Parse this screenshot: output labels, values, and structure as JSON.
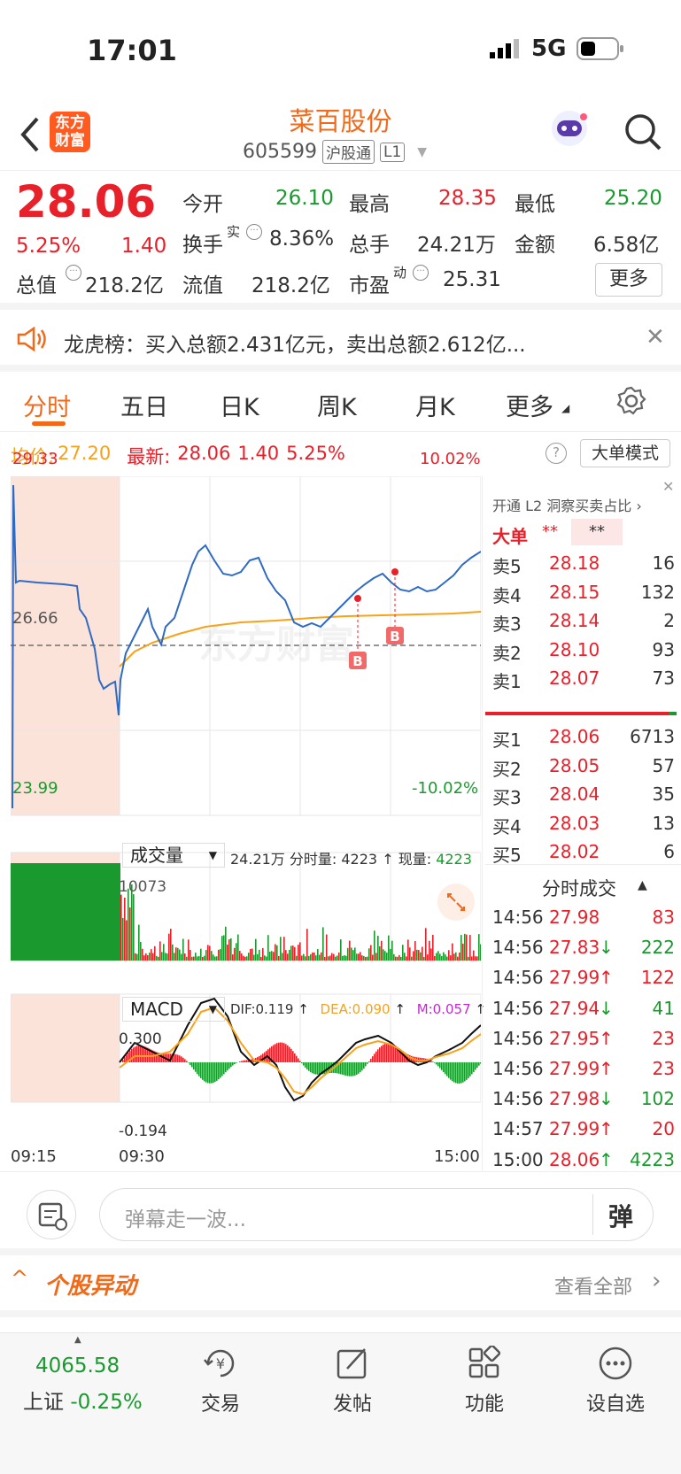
{
  "status_bar": {
    "time": "17:01",
    "network": "5G"
  },
  "header": {
    "title": "菜百股份",
    "code": "605599",
    "market_badge": "沪股通",
    "level_badge": "L1",
    "logo_text_line1": "东方",
    "logo_text_line2": "财富"
  },
  "quote": {
    "price": "28.06",
    "change_pct": "5.25%",
    "change": "1.40",
    "open_label": "今开",
    "open": "26.10",
    "high_label": "最高",
    "high": "28.35",
    "low_label": "最低",
    "low": "25.20",
    "turnover_label": "换手",
    "turnover_sup": "实",
    "turnover": "8.36%",
    "volume_label": "总手",
    "volume": "24.21万",
    "amount_label": "金额",
    "amount": "6.58亿",
    "mktcap_label": "总值",
    "mktcap": "218.2亿",
    "float_label": "流值",
    "float": "218.2亿",
    "pe_label": "市盈",
    "pe_sup": "动",
    "pe": "25.31",
    "more_button": "更多"
  },
  "notice": {
    "text": "龙虎榜：买入总额2.431亿元，卖出总额2.612亿..."
  },
  "tabs": [
    {
      "label": "分时",
      "active": true
    },
    {
      "label": "五日"
    },
    {
      "label": "日K"
    },
    {
      "label": "周K"
    },
    {
      "label": "月K"
    },
    {
      "label": "更多"
    }
  ],
  "chart_header": {
    "avg_label": "均价:",
    "avg": "27.20",
    "last_label": "最新:",
    "last": "28.06",
    "last_change": "1.40",
    "last_pct": "5.25%",
    "mode_button": "大单模式"
  },
  "price_axis": {
    "top": "29.33",
    "mid": "26.66",
    "bottom": "23.99",
    "top_pct": "10.02%",
    "bottom_pct": "-10.02%"
  },
  "watermark": "东方财富",
  "volume_bar": {
    "selector": "成交量",
    "info": "24.21万 分时量: 4223",
    "current_label": "现量:",
    "current": "4223",
    "max_label": "10073"
  },
  "macd_bar": {
    "selector": "MACD",
    "dif": "DIF:0.119",
    "dea": "DEA:0.090",
    "m": "M:0.057",
    "top": "0.300",
    "bottom": "-0.194"
  },
  "time_axis": {
    "t1": "09:15",
    "t2": "09:30",
    "t3": "15:00"
  },
  "orderbook": {
    "promo": "开通 L2 洞察买卖占比",
    "big_label": "大单",
    "big_value": "**",
    "big_value2": "**",
    "asks": [
      {
        "label": "卖5",
        "price": "28.18",
        "vol": "16"
      },
      {
        "label": "卖4",
        "price": "28.15",
        "vol": "132"
      },
      {
        "label": "卖3",
        "price": "28.14",
        "vol": "2"
      },
      {
        "label": "卖2",
        "price": "28.10",
        "vol": "93"
      },
      {
        "label": "卖1",
        "price": "28.07",
        "vol": "73"
      }
    ],
    "bids": [
      {
        "label": "买1",
        "price": "28.06",
        "vol": "6713"
      },
      {
        "label": "买2",
        "price": "28.05",
        "vol": "57"
      },
      {
        "label": "买3",
        "price": "28.04",
        "vol": "35"
      },
      {
        "label": "买4",
        "price": "28.03",
        "vol": "13"
      },
      {
        "label": "买5",
        "price": "28.02",
        "vol": "6"
      }
    ]
  },
  "ticks": {
    "title": "分时成交",
    "rows": [
      {
        "time": "14:56",
        "price": "27.98",
        "dir": "",
        "vol": "83",
        "color": "red"
      },
      {
        "time": "14:56",
        "price": "27.83",
        "dir": "↓",
        "vol": "222",
        "color": "green"
      },
      {
        "time": "14:56",
        "price": "27.99",
        "dir": "↑",
        "vol": "122",
        "color": "red"
      },
      {
        "time": "14:56",
        "price": "27.94",
        "dir": "↓",
        "vol": "41",
        "color": "green"
      },
      {
        "time": "14:56",
        "price": "27.95",
        "dir": "↑",
        "vol": "23",
        "color": "red"
      },
      {
        "time": "14:56",
        "price": "27.99",
        "dir": "↑",
        "vol": "23",
        "color": "red"
      },
      {
        "time": "14:56",
        "price": "27.98",
        "dir": "↓",
        "vol": "102",
        "color": "green"
      },
      {
        "time": "14:57",
        "price": "27.99",
        "dir": "↑",
        "vol": "20",
        "color": "red"
      },
      {
        "time": "15:00",
        "price": "28.06",
        "dir": "↑",
        "vol": "4223",
        "color": "green"
      }
    ]
  },
  "danmu": {
    "placeholder": "弹幕走一波...",
    "button": "弹"
  },
  "movers": {
    "title": "个股异动",
    "link": "查看全部"
  },
  "bottom_nav": {
    "index_value": "4065.58",
    "index_name": "上证",
    "index_pct": "-0.25%",
    "items": [
      {
        "label": "交易"
      },
      {
        "label": "发帖"
      },
      {
        "label": "功能"
      },
      {
        "label": "设自选"
      }
    ]
  },
  "colors": {
    "up": "#e8202a",
    "down": "#1a9a2e",
    "accent": "#f06a1a",
    "avg_line": "#f7a21a",
    "price_line": "#2f6bc4"
  }
}
